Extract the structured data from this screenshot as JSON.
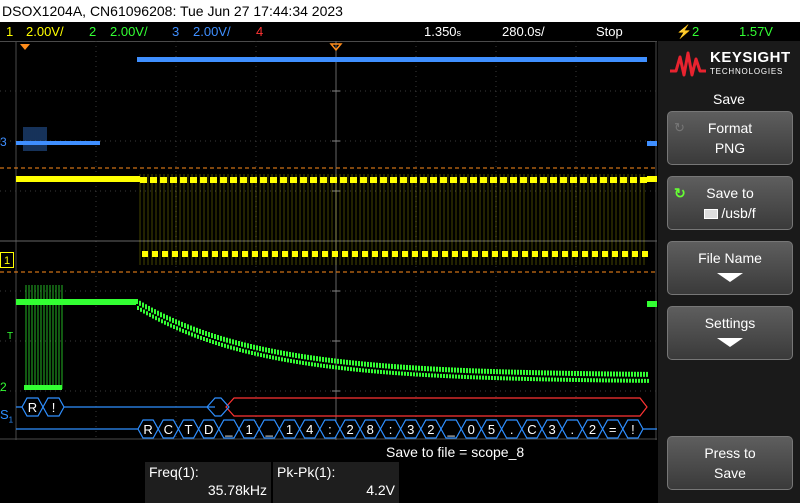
{
  "title_bar": "DSOX1204A, CN61096208: Tue Jun 27 17:44:34 2023",
  "status": {
    "ch1_num": "1",
    "ch1_scale": "2.00V/",
    "ch2_num": "2",
    "ch2_scale": "2.00V/",
    "ch3_num": "3",
    "ch3_scale": "2.00V/",
    "ch4_num": "4",
    "time_div": "1.350",
    "time_unit": "s",
    "delay": "280.0",
    "delay_unit": "s/",
    "run_state": "Stop",
    "trigger_ch": "2",
    "trigger_level": "1.57V"
  },
  "colors": {
    "ch1": "#ffff00",
    "ch2": "#33ff33",
    "ch3": "#3f8fff",
    "ch4": "#ff3333",
    "decode": "#2f8fff",
    "accent": "#ff8c1a"
  },
  "channel_markers": {
    "ch3": "3",
    "ch1": "1",
    "trigger": "T",
    "ch2": "2",
    "serial": "S",
    "serial_sub": "1"
  },
  "decode_row1": [
    "R",
    "!"
  ],
  "decode_row2": [
    "R",
    "C",
    "T",
    "D",
    "_",
    "1",
    "_",
    "1",
    "4",
    ":",
    "2",
    "8",
    ":",
    "3",
    "2",
    "_",
    "0",
    "5",
    ".",
    "C",
    "3",
    ".",
    "2",
    "=",
    "!"
  ],
  "side_panel": {
    "brand": "KEYSIGHT",
    "brand_sub": "TECHNOLOGIES",
    "menu_title": "Save",
    "format_label": "Format",
    "format_value": "PNG",
    "save_to_label": "Save to",
    "save_to_value": "/usb/f",
    "file_name_label": "File Name",
    "settings_label": "Settings",
    "press_label": "Press to",
    "save_label": "Save"
  },
  "bottom": {
    "message": "Save to file = scope_8",
    "freq_label": "Freq(1):",
    "freq_value": "35.78kHz",
    "pkpk_label": "Pk-Pk(1):",
    "pkpk_value": "4.2V"
  }
}
